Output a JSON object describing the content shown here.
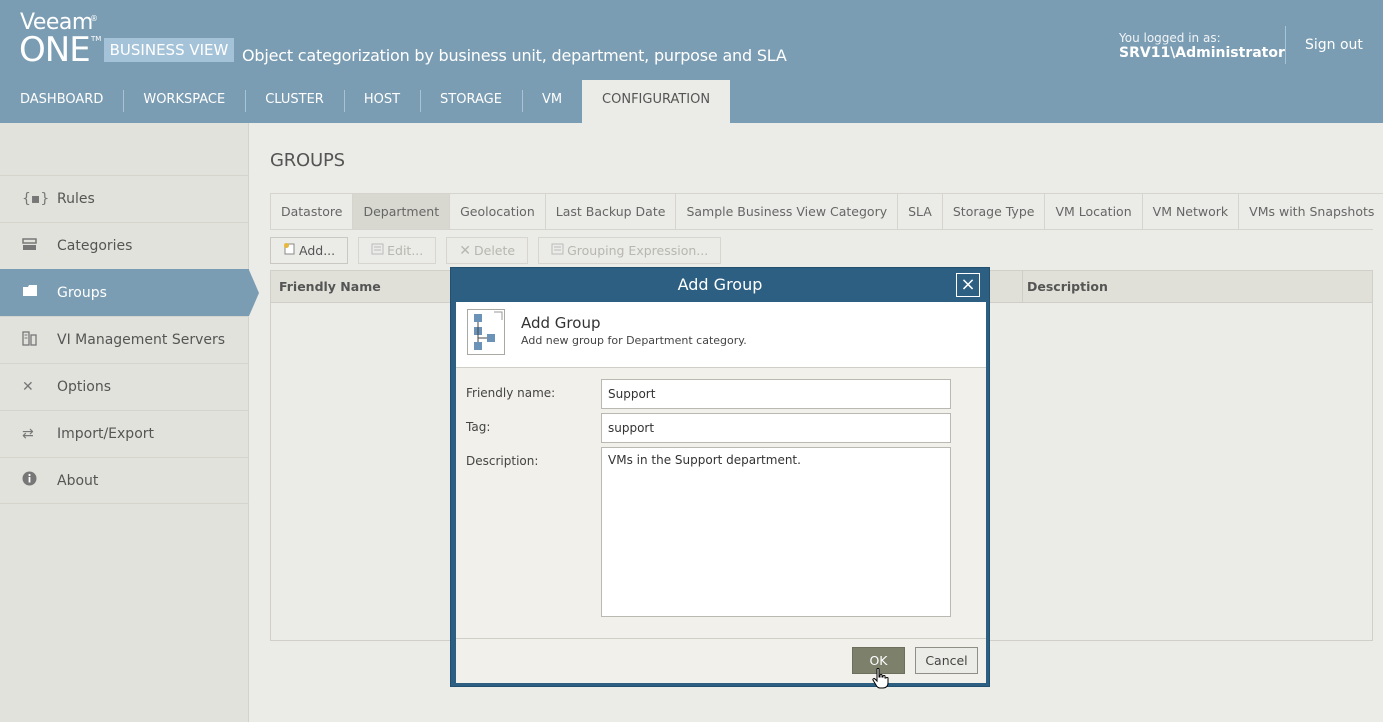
{
  "brand": {
    "veeam": "Veeam",
    "one": "ONE",
    "edition": "BUSINESS VIEW",
    "tagline": "Object categorization by business unit, department, purpose and SLA",
    "reg_mark": "®",
    "tm_mark": "TM"
  },
  "user": {
    "label": "You logged in as:",
    "name": "SRV11\\Administrator",
    "signout": "Sign out"
  },
  "nav": [
    {
      "label": "DASHBOARD"
    },
    {
      "label": "WORKSPACE"
    },
    {
      "label": "CLUSTER"
    },
    {
      "label": "HOST"
    },
    {
      "label": "STORAGE"
    },
    {
      "label": "VM"
    },
    {
      "label": "CONFIGURATION",
      "active": true
    }
  ],
  "sidebar": {
    "items": [
      {
        "label": "Rules",
        "icon": "braces-icon"
      },
      {
        "label": "Categories",
        "icon": "drawer-icon"
      },
      {
        "label": "Groups",
        "icon": "folder-icon",
        "active": true
      },
      {
        "label": "VI Management Servers",
        "icon": "server-icon"
      },
      {
        "label": "Options",
        "icon": "tools-icon"
      },
      {
        "label": "Import/Export",
        "icon": "import-export-icon"
      },
      {
        "label": "About",
        "icon": "info-icon"
      }
    ]
  },
  "page": {
    "title": "GROUPS"
  },
  "tabs": [
    {
      "label": "Datastore"
    },
    {
      "label": "Department",
      "active": true
    },
    {
      "label": "Geolocation"
    },
    {
      "label": "Last Backup Date"
    },
    {
      "label": "Sample Business View Category"
    },
    {
      "label": "SLA"
    },
    {
      "label": "Storage Type"
    },
    {
      "label": "VM Location"
    },
    {
      "label": "VM Network"
    },
    {
      "label": "VMs with Snapshots"
    }
  ],
  "toolbar": {
    "add": "Add...",
    "edit": "Edit...",
    "delete": "Delete",
    "grouping": "Grouping Expression..."
  },
  "grid": {
    "columns": [
      "Friendly Name",
      "Description"
    ]
  },
  "dialog": {
    "title": "Add Group",
    "close": "×",
    "heading": "Add Group",
    "subheading": "Add new group for Department category.",
    "fields": {
      "friendly_name_label": "Friendly name:",
      "friendly_name_value": "Support",
      "tag_label": "Tag:",
      "tag_value": "support",
      "description_label": "Description:",
      "description_value": "VMs in the Support department."
    },
    "ok": "OK",
    "cancel": "Cancel"
  },
  "colors": {
    "header": "#7b9db3",
    "dialog_frame": "#2c5f82",
    "ok_button": "#7d806b"
  }
}
